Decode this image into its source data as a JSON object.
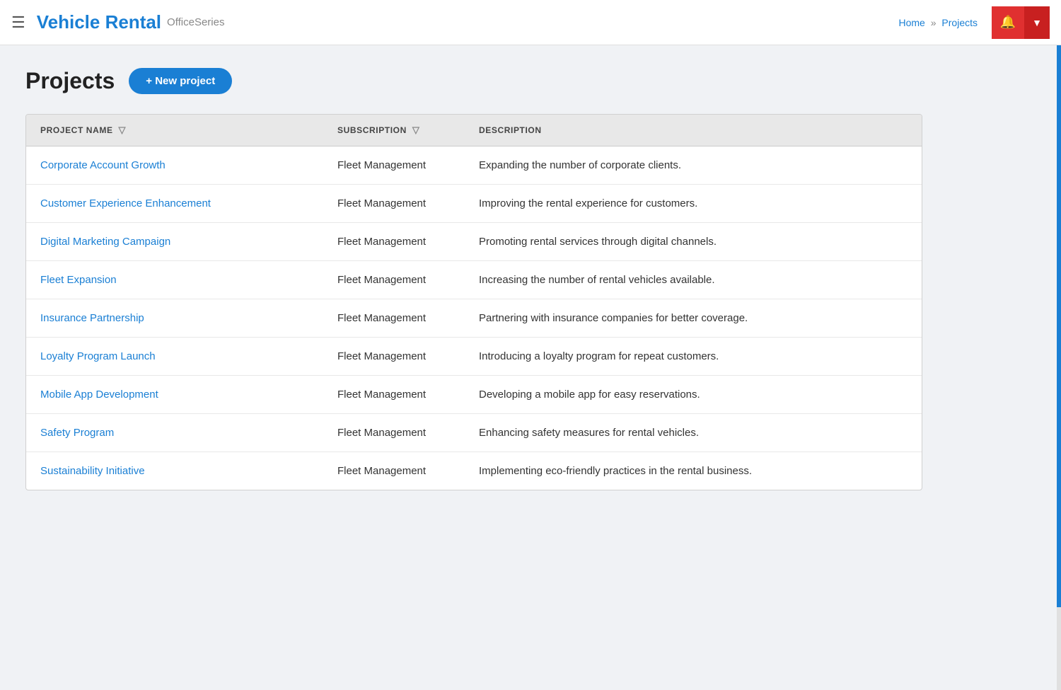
{
  "header": {
    "menu_icon": "☰",
    "logo": "Vehicle Rental",
    "subtitle": "OfficeSeries",
    "breadcrumb": {
      "home": "Home",
      "separator": "»",
      "current": "Projects"
    },
    "bell_icon": "🔔",
    "dropdown_icon": "▼"
  },
  "page": {
    "title": "Projects",
    "new_project_btn": "+ New project"
  },
  "table": {
    "columns": [
      {
        "key": "name",
        "label": "PROJECT NAME",
        "has_filter": true
      },
      {
        "key": "subscription",
        "label": "SUBSCRIPTION",
        "has_filter": true
      },
      {
        "key": "description",
        "label": "DESCRIPTION",
        "has_filter": false
      }
    ],
    "rows": [
      {
        "name": "Corporate Account Growth",
        "subscription": "Fleet Management",
        "description": "Expanding the number of corporate clients."
      },
      {
        "name": "Customer Experience Enhancement",
        "subscription": "Fleet Management",
        "description": "Improving the rental experience for customers."
      },
      {
        "name": "Digital Marketing Campaign",
        "subscription": "Fleet Management",
        "description": "Promoting rental services through digital channels."
      },
      {
        "name": "Fleet Expansion",
        "subscription": "Fleet Management",
        "description": "Increasing the number of rental vehicles available."
      },
      {
        "name": "Insurance Partnership",
        "subscription": "Fleet Management",
        "description": "Partnering with insurance companies for better coverage."
      },
      {
        "name": "Loyalty Program Launch",
        "subscription": "Fleet Management",
        "description": "Introducing a loyalty program for repeat customers."
      },
      {
        "name": "Mobile App Development",
        "subscription": "Fleet Management",
        "description": "Developing a mobile app for easy reservations."
      },
      {
        "name": "Safety Program",
        "subscription": "Fleet Management",
        "description": "Enhancing safety measures for rental vehicles."
      },
      {
        "name": "Sustainability Initiative",
        "subscription": "Fleet Management",
        "description": "Implementing eco-friendly practices in the rental business."
      }
    ]
  }
}
